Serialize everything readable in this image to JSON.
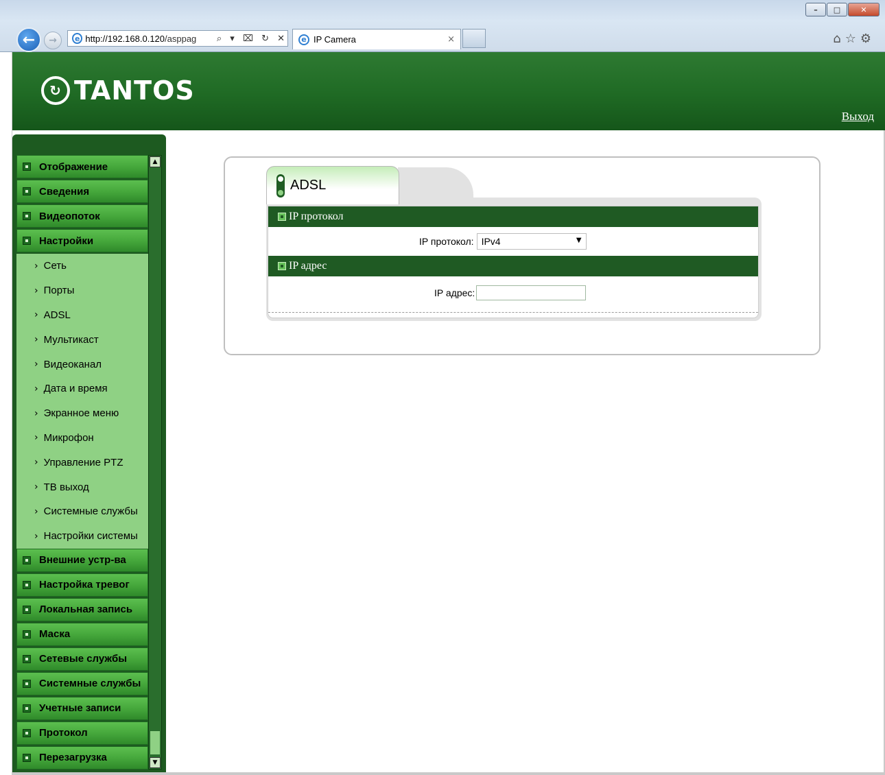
{
  "browser": {
    "url_host": "http://192.168.0.120",
    "url_rest": "/asppag",
    "tab_title": "IP Camera",
    "address_tools": "⌕ ▾ ⌧ ↻ ✕"
  },
  "header": {
    "logo": "TANTOS",
    "logout": "Выход"
  },
  "sidebar": {
    "top": [
      {
        "label": "Отображение"
      },
      {
        "label": "Сведения"
      },
      {
        "label": "Видеопоток"
      },
      {
        "label": "Настройки"
      }
    ],
    "settings_items": [
      {
        "label": "Сеть"
      },
      {
        "label": "Порты"
      },
      {
        "label": "ADSL"
      },
      {
        "label": "Мультикаст"
      },
      {
        "label": "Видеоканал"
      },
      {
        "label": "Дата и время"
      },
      {
        "label": "Экранное меню"
      },
      {
        "label": "Микрофон"
      },
      {
        "label": "Управление PTZ"
      },
      {
        "label": "ТВ выход"
      },
      {
        "label": "Системные службы"
      },
      {
        "label": "Настройки системы"
      }
    ],
    "bottom": [
      {
        "label": "Внешние устр-ва"
      },
      {
        "label": "Настройка тревог"
      },
      {
        "label": "Локальная запись"
      },
      {
        "label": "Маска"
      },
      {
        "label": "Сетевые службы"
      },
      {
        "label": "Системные службы"
      },
      {
        "label": "Учетные записи"
      },
      {
        "label": "Протокол"
      },
      {
        "label": "Перезагрузка"
      }
    ]
  },
  "panel": {
    "tab_label": "ADSL",
    "section1_title": "IP протокол",
    "protocol_label": "IP протокол:",
    "protocol_value": "IPv4",
    "section2_title": "IP адрес",
    "address_label": "IP адрес:",
    "address_value": ""
  },
  "colors": {
    "brand_green": "#1f6a24",
    "menu_green": "#46a83c",
    "submenu_green": "#8fd184",
    "section_green": "#1f5a23"
  },
  "icons": [
    "back-arrow-icon",
    "forward-arrow-icon",
    "ie-icon",
    "home-icon",
    "star-icon",
    "gear-icon",
    "chevron-right-icon",
    "menu-bullet-icon",
    "toggle-icon",
    "dropdown-arrow-icon"
  ]
}
